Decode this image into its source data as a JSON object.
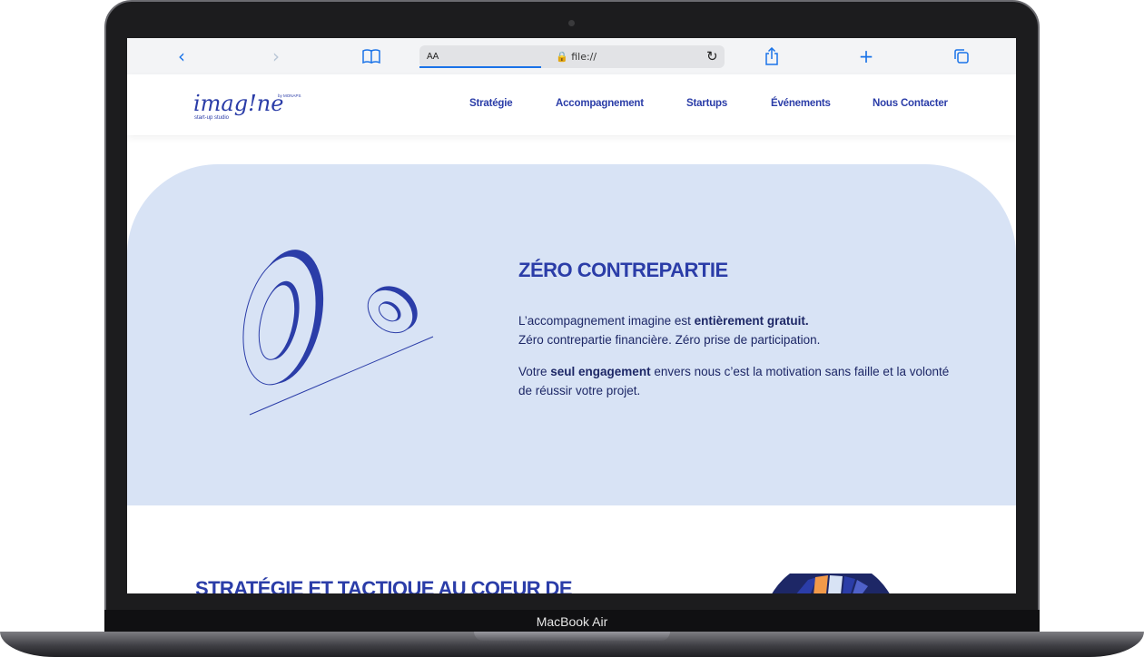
{
  "device": {
    "label": "MacBook Air"
  },
  "browser": {
    "aa_label": "AA",
    "url": "file://",
    "colors": {
      "accent": "#1a73e8"
    }
  },
  "site": {
    "logo": {
      "name": "imag!ne",
      "byline": "by MONAPS",
      "tagline": "start-up studio"
    },
    "nav": [
      {
        "label": "Stratégie"
      },
      {
        "label": "Accompagnement"
      },
      {
        "label": "Startups"
      },
      {
        "label": "Événements"
      },
      {
        "label": "Nous Contacter"
      }
    ]
  },
  "hero": {
    "title": "ZÉRO CONTREPARTIE",
    "line1_pre": "L’accompagnement imagine est ",
    "line1_bold": "entièrement gratuit.",
    "line2": "Zéro contrepartie financière. Zéro prise de participation.",
    "para2_pre": "Votre ",
    "para2_bold": "seul engagement",
    "para2_post": " envers nous c’est la motivation sans faille et la volonté de réussir votre projet."
  },
  "section2": {
    "title": "STRATÉGIE ET TACTIQUE AU COEUR DE"
  },
  "colors": {
    "brand": "#2b3da8",
    "hero_bg": "#d8e3f5",
    "text_dark": "#1d2766",
    "orange": "#f29a4a"
  }
}
